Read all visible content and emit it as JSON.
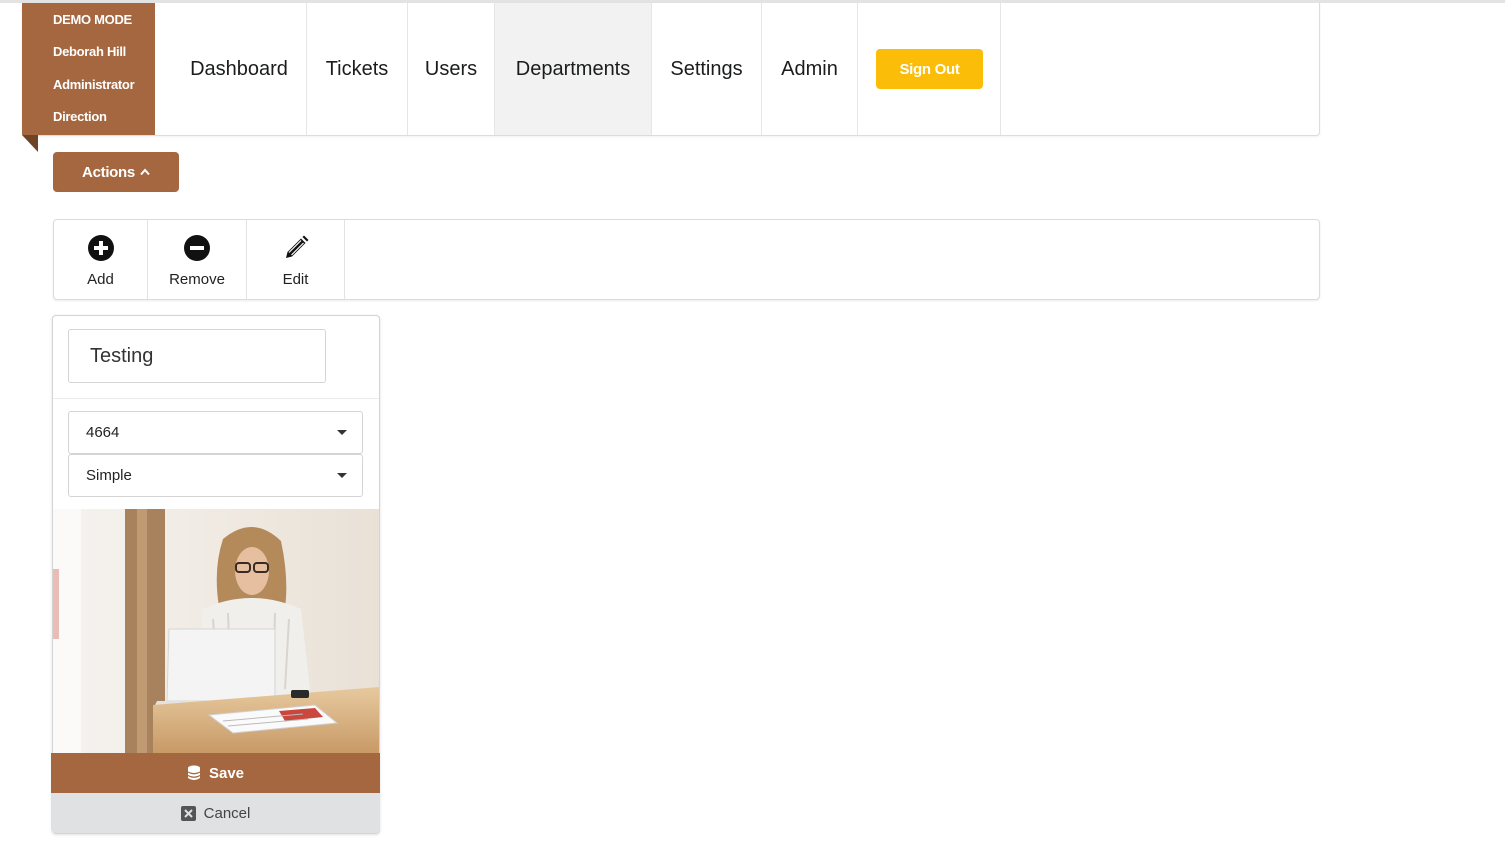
{
  "user": {
    "mode": "DEMO MODE",
    "name": "Deborah Hill",
    "role": "Administrator",
    "department": "Direction"
  },
  "nav": {
    "items": [
      {
        "label": "Dashboard"
      },
      {
        "label": "Tickets"
      },
      {
        "label": "Users"
      },
      {
        "label": "Departments",
        "active": true
      },
      {
        "label": "Settings"
      },
      {
        "label": "Admin"
      }
    ],
    "sign_out": "Sign Out"
  },
  "actions": {
    "label": "Actions",
    "icon": "chevron-up-icon"
  },
  "toolbar": {
    "add": {
      "label": "Add",
      "icon": "plus-circle-icon"
    },
    "remove": {
      "label": "Remove",
      "icon": "minus-circle-icon"
    },
    "edit": {
      "label": "Edit",
      "icon": "pencil-icon"
    }
  },
  "form": {
    "name_value": "Testing",
    "select_one": "4664",
    "select_two": "Simple",
    "save_label": "Save",
    "save_icon": "database-icon",
    "cancel_label": "Cancel",
    "cancel_icon": "close-box-icon"
  },
  "colors": {
    "brand": "#a5673f",
    "sign_out": "#fbbd08",
    "cancel_bg": "#e0e1e2"
  }
}
